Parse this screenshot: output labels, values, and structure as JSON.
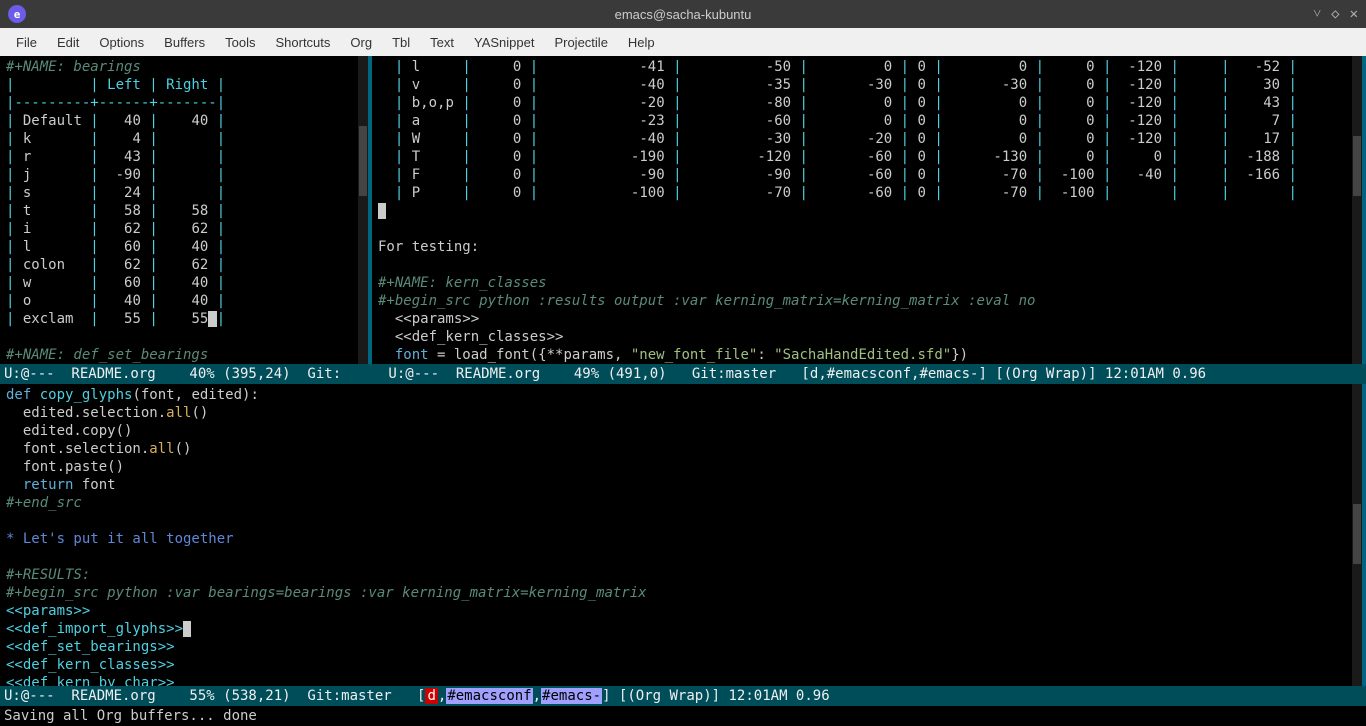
{
  "titlebar": {
    "app_icon": "e",
    "title": "emacs@sacha-kubuntu"
  },
  "menubar": [
    "File",
    "Edit",
    "Options",
    "Buffers",
    "Tools",
    "Shortcuts",
    "Org",
    "Tbl",
    "Text",
    "YASnippet",
    "Projectile",
    "Help"
  ],
  "pane_left": {
    "name_line": "#+NAME: bearings",
    "header": "|         | Left | Right |",
    "divider": "|---------+------+-------|",
    "rows": [
      [
        "Default",
        "40",
        "40"
      ],
      [
        "k",
        "4",
        ""
      ],
      [
        "r",
        "43",
        ""
      ],
      [
        "j",
        "-90",
        ""
      ],
      [
        "s",
        "24",
        ""
      ],
      [
        "t",
        "58",
        "58"
      ],
      [
        "i",
        "62",
        "62"
      ],
      [
        "l",
        "60",
        "40"
      ],
      [
        "colon",
        "62",
        "62"
      ],
      [
        "w",
        "60",
        "40"
      ],
      [
        "o",
        "40",
        "40"
      ],
      [
        "exclam",
        "55",
        "55"
      ]
    ],
    "footer": "#+NAME: def_set_bearings"
  },
  "pane_right": {
    "matrix_rows": [
      [
        "l",
        "0",
        "-41",
        "-50",
        "0",
        "0",
        "0",
        "0",
        "-120",
        "",
        "-52"
      ],
      [
        "v",
        "0",
        "-40",
        "-35",
        "-30",
        "0",
        "-30",
        "0",
        "-120",
        "",
        "30"
      ],
      [
        "b,o,p",
        "0",
        "-20",
        "-80",
        "0",
        "0",
        "0",
        "0",
        "-120",
        "",
        "43"
      ],
      [
        "a",
        "0",
        "-23",
        "-60",
        "0",
        "0",
        "0",
        "0",
        "-120",
        "",
        "7"
      ],
      [
        "W",
        "0",
        "-40",
        "-30",
        "-20",
        "0",
        "0",
        "0",
        "-120",
        "",
        "17"
      ],
      [
        "T",
        "0",
        "-190",
        "-120",
        "-60",
        "0",
        "-130",
        "0",
        "0",
        "",
        "-188"
      ],
      [
        "F",
        "0",
        "-90",
        "-90",
        "-60",
        "0",
        "-70",
        "-100",
        "-40",
        "",
        "-166"
      ],
      [
        "P",
        "0",
        "-100",
        "-70",
        "-60",
        "0",
        "-70",
        "-100",
        "",
        "",
        ""
      ]
    ],
    "text1": "For testing:",
    "name_line": "#+NAME: kern_classes",
    "begin_src": "#+begin_src python :results output :var kerning_matrix=kerning_matrix :eval no",
    "noweb1": "<<params>>",
    "noweb2": "<<def_kern_classes>>",
    "code_font": "font",
    "code_eq": " = load_font({**params, ",
    "code_key": "\"new_font_file\"",
    "code_colon": ": ",
    "code_val": "\"SachaHandEdited.sfd\"",
    "code_end": "})"
  },
  "modeline_top": {
    "left": "U:@---  README.org    40% (395,24)  Git:",
    "right_prefix": " U:@---  README.org    49% (491,0)   Git:master   [",
    "right_mid": "] [(Org Wrap)] 12:01AM 0.96"
  },
  "pane_bottom": {
    "l1_kw": "def",
    "l1_fn": " copy_glyphs",
    "l1_rest": "(font, edited):",
    "l2": "  edited.selection.",
    "l2_fn": "all",
    "l2_rest": "()",
    "l3": "  edited.copy()",
    "l4": "  font.selection.",
    "l4_fn": "all",
    "l4_rest": "()",
    "l5": "  font.paste()",
    "l6_kw": "  return",
    "l6_rest": " font",
    "l7": "#+end_src",
    "h1": "* Let's put it all together",
    "r1": "#+RESULTS:",
    "bs": "#+begin_src python :var bearings=bearings :var kerning_matrix=kerning_matrix",
    "nw1": "<<params>>",
    "nw2": "<<def_import_glyphs>>",
    "nw3": "<<def_set_bearings>>",
    "nw4": "<<def_kern_classes>>",
    "nw5": "<<def_kern_by_char>>"
  },
  "modeline_bottom": {
    "text": "U:@---  README.org    55% (538,21)  Git:master   [",
    "mid": "] [(Org Wrap)] 12:01AM 0.96"
  },
  "minibuffer": "Saving all Org buffers... done",
  "colors": {
    "d": "#c00",
    "chan_bg": "#a0a0ff"
  },
  "chan1": "#emacsconf",
  "chan2": "#emacs-",
  "d_char": "d"
}
